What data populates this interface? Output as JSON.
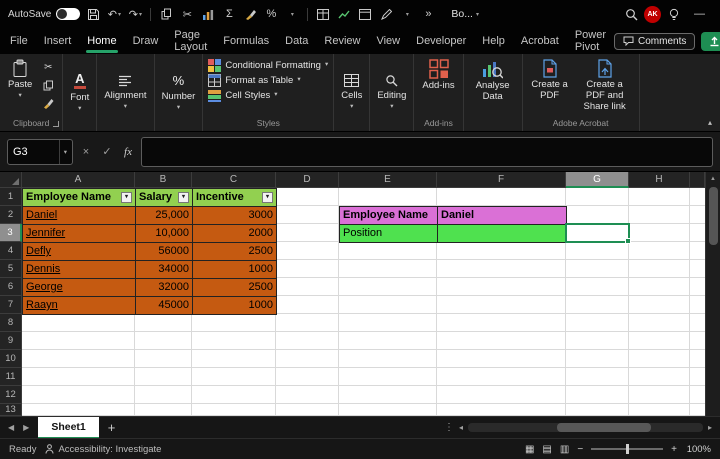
{
  "titlebar": {
    "autosave_label": "AutoSave",
    "workbook_label": "Bo...",
    "avatar_initials": "AK"
  },
  "icons": {
    "undo": "↶",
    "redo": "↷",
    "dropdown": "▾",
    "cut": "✂",
    "sigma": "Σ",
    "percent": "%",
    "overflow": "»",
    "more_vert": "⋮",
    "minimize": "—",
    "restore": "▢",
    "close_x": "×",
    "check": "✓",
    "fx": "fx",
    "plus": "+",
    "minus": "−",
    "left_arrow": "◀",
    "right_arrow": "▶",
    "small_left": "◂",
    "small_right": "▸",
    "up_arrow": "▲",
    "grid_view": "▦",
    "page_layout_view": "▤",
    "page_break_view": "▥",
    "font_a": "A",
    "collapse": "▴"
  },
  "ribbon_tabs": [
    "File",
    "Insert",
    "Home",
    "Draw",
    "Page Layout",
    "Formulas",
    "Data",
    "Review",
    "View",
    "Developer",
    "Help",
    "Acrobat",
    "Power Pivot"
  ],
  "tabrow_right": {
    "comments_label": "Comments"
  },
  "ribbon": {
    "paste_label": "Paste",
    "clipboard_group": "Clipboard",
    "font_label": "Font",
    "alignment_label": "Alignment",
    "number_label": "Number",
    "conditional_formatting_label": "Conditional Formatting",
    "format_as_table_label": "Format as Table",
    "cell_styles_label": "Cell Styles",
    "styles_group": "Styles",
    "cells_label": "Cells",
    "editing_label": "Editing",
    "addins_label": "Add-ins",
    "addins_group": "Add-ins",
    "analyse_data_label": "Analyse Data",
    "create_pdf_label": "Create a PDF",
    "create_pdf_share_label": "Create a PDF and Share link",
    "adobe_group": "Adobe Acrobat"
  },
  "formula_bar": {
    "name_box": "G3",
    "formula_value": ""
  },
  "grid": {
    "columns": [
      "A",
      "B",
      "C",
      "D",
      "E",
      "F",
      "G",
      "H"
    ],
    "row_numbers": [
      "1",
      "2",
      "3",
      "4",
      "5",
      "6",
      "7",
      "8",
      "9",
      "10",
      "11",
      "12",
      "13"
    ],
    "active_column": "G",
    "active_row": "3",
    "active_cell": "G3",
    "table": {
      "headers": [
        "Employee Name",
        "Salary",
        "Incentive"
      ],
      "rows": [
        [
          "Daniel",
          "25,000",
          "3000"
        ],
        [
          "Jennifer",
          "10,000",
          "2000"
        ],
        [
          "Defly",
          "56000",
          "2500"
        ],
        [
          "Dennis",
          "34000",
          "1000"
        ],
        [
          "George",
          "32000",
          "2500"
        ],
        [
          "Raayn",
          "45000",
          "1000"
        ]
      ]
    },
    "lookup": {
      "r1c1": "Employee Name",
      "r1c2": "Daniel",
      "r2c1": "Position",
      "r2c2": ""
    }
  },
  "sheet_bar": {
    "tabs": [
      "Sheet1"
    ],
    "active_tab": "Sheet1"
  },
  "status_bar": {
    "mode": "Ready",
    "accessibility": "Accessibility: Investigate",
    "zoom": "100%"
  },
  "colors": {
    "accent_green": "#1E8E53",
    "table_header_fill": "#92D050",
    "table_data_fill": "#C55A11",
    "lookup_fill": "#DA70D6",
    "position_fill": "#4FE14F",
    "avatar_bg": "#C00000"
  }
}
